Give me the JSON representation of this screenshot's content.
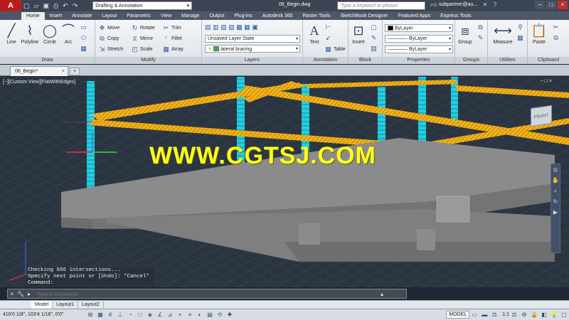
{
  "app": {
    "logo": "A",
    "workspace": "Drafting & Annotation",
    "doc_title": "06_Begin.dwg",
    "search_placeholder": "Type a keyword or phrase",
    "user": "subpartner@au..."
  },
  "ribbon_tabs": [
    "Home",
    "Insert",
    "Annotate",
    "Layout",
    "Parametric",
    "View",
    "Manage",
    "Output",
    "Plug-ins",
    "Autodesk 360",
    "Raster Tools",
    "SketchBook Designer",
    "Featured Apps",
    "Express Tools"
  ],
  "ribbon": {
    "draw": {
      "title": "Draw",
      "line": "Line",
      "polyline": "Polyline",
      "circle": "Circle",
      "arc": "Arc"
    },
    "modify": {
      "title": "Modify",
      "move": "Move",
      "rotate": "Rotate",
      "trim": "Trim",
      "copy": "Copy",
      "mirror": "Mirror",
      "fillet": "Fillet",
      "stretch": "Stretch",
      "scale": "Scale",
      "array": "Array"
    },
    "layers": {
      "title": "Layers",
      "layer_state": "Unsaved Layer State",
      "current_layer": "lateral bracing"
    },
    "annotation": {
      "title": "Annotation",
      "text": "Text",
      "table": "Table"
    },
    "block": {
      "title": "Block",
      "insert": "Insert"
    },
    "properties": {
      "title": "Properties",
      "color": "ByLayer",
      "linetype": "ByLayer",
      "lineweight": "ByLayer"
    },
    "groups": {
      "title": "Groups",
      "group": "Group"
    },
    "utilities": {
      "title": "Utilities",
      "measure": "Measure"
    },
    "clipboard": {
      "title": "Clipboard",
      "paste": "Paste"
    }
  },
  "file_tab": {
    "name": "06_Begin*"
  },
  "viewport": {
    "label": "[−][Custom View][FlatWithEdges]",
    "watermark": "WWW.CGTSJ.COM",
    "viewcube_label": "FRONT",
    "close": "− □ ×"
  },
  "command_line": {
    "history": [
      "Checking 666 intersections...",
      "Specify next point or [Undo]: *Cancel*",
      "Command:"
    ],
    "placeholder": "Type a command"
  },
  "layout_tabs": [
    "Model",
    "Layout1",
    "Layout2"
  ],
  "status": {
    "coords": "416'0 1/8\", 103'4 1/16\", 0'0\"",
    "model": "MODEL",
    "scale": "1:1"
  },
  "colors": {
    "beam": "#f3b21b",
    "column": "#2fdbe6",
    "slab": "#8a8a8a",
    "background": "#2b3542",
    "watermark": "#ffff1c"
  }
}
